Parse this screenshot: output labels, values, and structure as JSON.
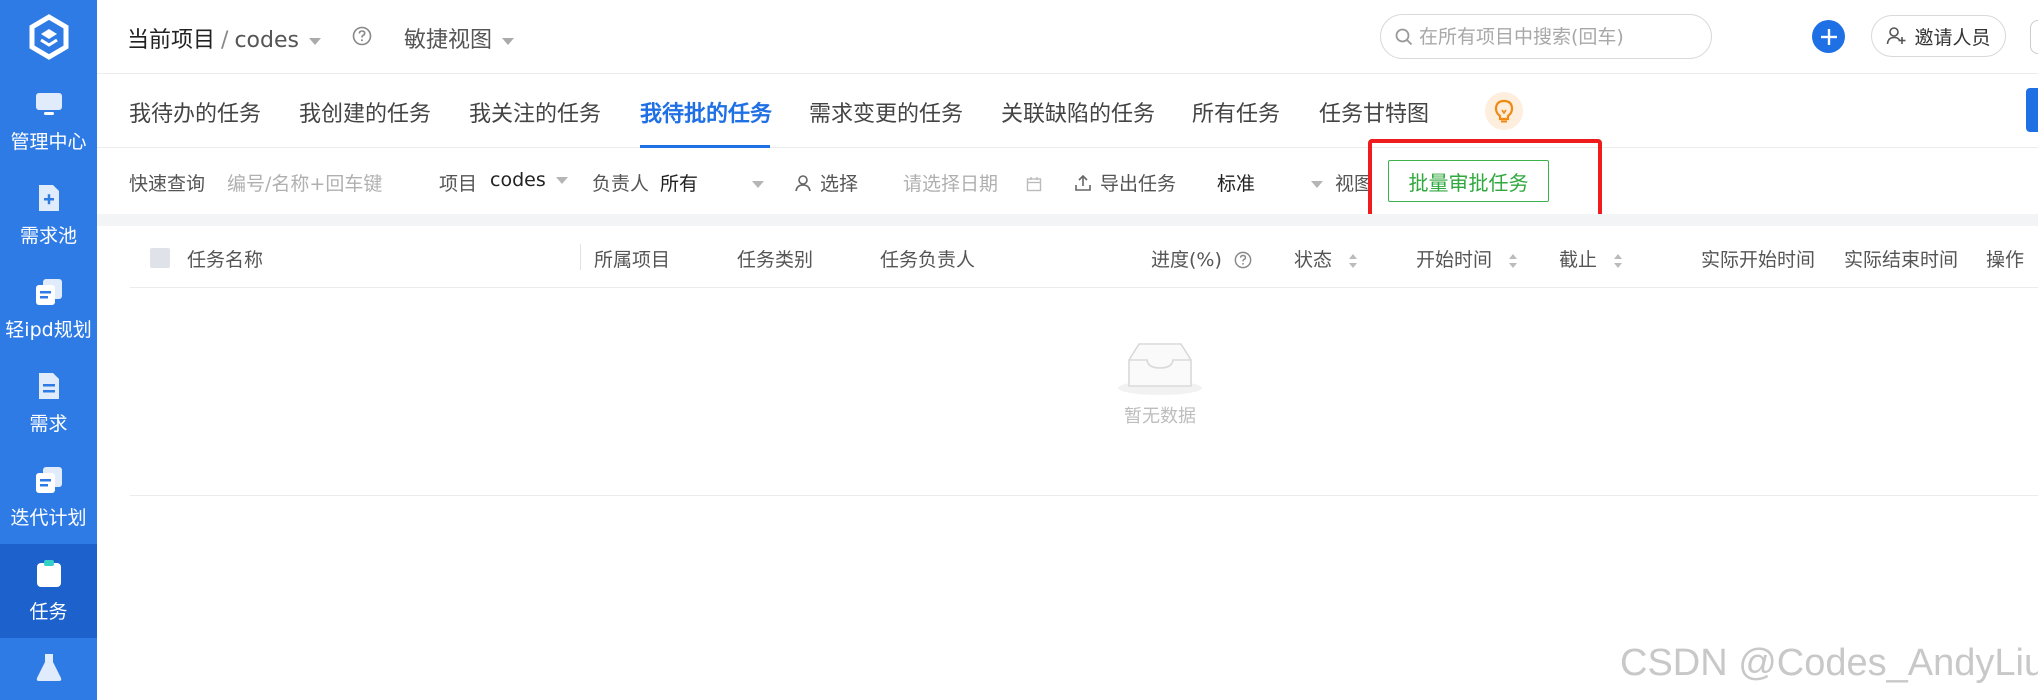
{
  "sidebar": {
    "items": [
      {
        "label": "管理中心",
        "icon": "monitor-icon"
      },
      {
        "label": "需求池",
        "icon": "doc-plus-icon"
      },
      {
        "label": "轻ipd规划",
        "icon": "copy-docs-icon"
      },
      {
        "label": "需求",
        "icon": "doc-icon"
      },
      {
        "label": "迭代计划",
        "icon": "copy-docs-icon"
      },
      {
        "label": "任务",
        "icon": "clipboard-icon",
        "active": true
      },
      {
        "label": "",
        "icon": "flask-icon"
      }
    ]
  },
  "header": {
    "crumb_root": "当前项目",
    "crumb_sep": "/",
    "crumb_project": "codes",
    "view_label": "敏捷视图",
    "search_placeholder": "在所有项目中搜索(回车)",
    "invite_label": "邀请人员"
  },
  "tabs": [
    {
      "label": "我待办的任务"
    },
    {
      "label": "我创建的任务"
    },
    {
      "label": "我关注的任务"
    },
    {
      "label": "我待批的任务",
      "active": true
    },
    {
      "label": "需求变更的任务"
    },
    {
      "label": "关联缺陷的任务"
    },
    {
      "label": "所有任务"
    },
    {
      "label": "任务甘特图"
    }
  ],
  "filters": {
    "quick_query_label": "快速查询",
    "quick_query_placeholder": "编号/名称+回车键",
    "project_label": "项目",
    "project_value": "codes",
    "owner_label": "负责人",
    "owner_value": "所有",
    "select_label": "选择",
    "date_placeholder": "请选择日期",
    "export_label": "导出任务",
    "standard_label": "标准",
    "view_label": "视图",
    "batch_approve_label": "批量审批任务"
  },
  "table": {
    "columns": [
      "任务名称",
      "所属项目",
      "任务类别",
      "任务负责人",
      "进度(%)",
      "状态",
      "开始时间",
      "截止",
      "实际开始时间",
      "实际结束时间",
      "操作"
    ],
    "empty_text": "暂无数据"
  },
  "watermark": "CSDN @Codes_AndyLiu",
  "colors": {
    "sidebar": "#2f7be6",
    "accent": "#1f6fe5",
    "approve_green": "#2fa83e",
    "highlight_red": "#ee1c1c"
  }
}
